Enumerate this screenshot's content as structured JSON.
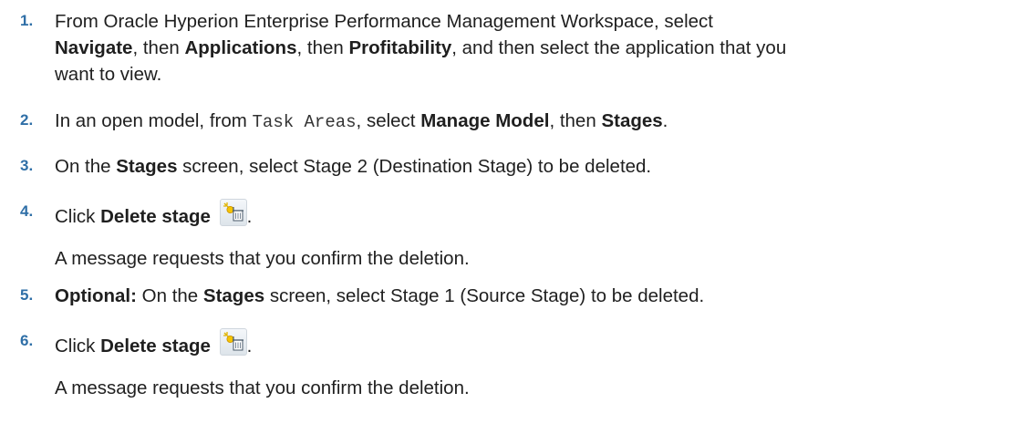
{
  "steps": [
    {
      "num": "1.",
      "t1": "From Oracle Hyperion Enterprise Performance Management Workspace, select",
      "b1": "Navigate",
      "t2": ", then ",
      "b2": "Applications",
      "t3": ", then ",
      "b3": "Profitability",
      "t4": ", and then select the application that you",
      "t5": "want to view."
    },
    {
      "num": "2.",
      "t1": "In an open model, from ",
      "code": "Task Areas",
      "t2": ", select ",
      "b1": "Manage Model",
      "t3": ", then ",
      "b2": "Stages",
      "t4": "."
    },
    {
      "num": "3.",
      "t1": "On the ",
      "b1": "Stages",
      "t2": " screen, select Stage 2 (Destination Stage) to be deleted."
    },
    {
      "num": "4.",
      "t1": "Click ",
      "b1": "Delete stage",
      "icon": "delete-stage-icon",
      "t2": ".",
      "note": "A message requests that you confirm the deletion."
    },
    {
      "num": "5.",
      "b0": "Optional:",
      "t1": " On the ",
      "b1": "Stages",
      "t2": " screen, select Stage 1 (Source Stage) to be deleted."
    },
    {
      "num": "6.",
      "t1": "Click ",
      "b1": "Delete stage",
      "icon": "delete-stage-icon",
      "t2": ".",
      "note": "A message requests that you confirm the deletion."
    }
  ]
}
